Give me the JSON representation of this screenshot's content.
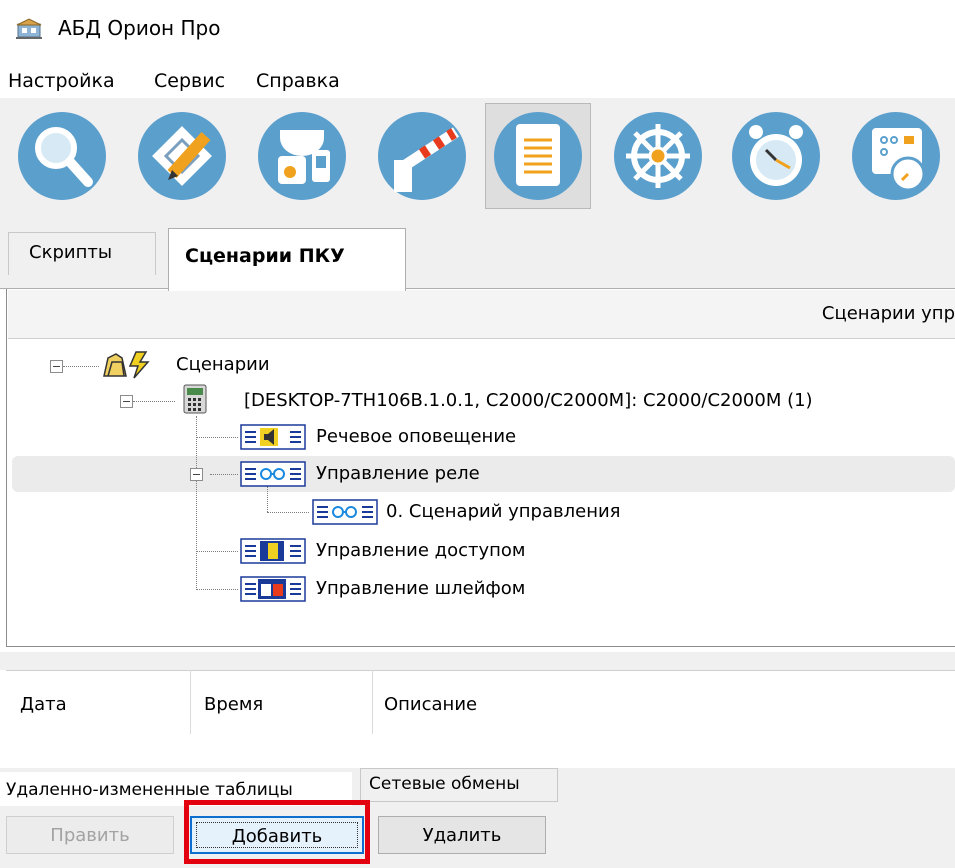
{
  "window": {
    "title": "АБД Орион Про",
    "icon": "app-icon"
  },
  "menu": {
    "items": [
      "Настройка",
      "Сервис",
      "Справка"
    ]
  },
  "toolbar": {
    "icons": [
      "search-icon",
      "plan-edit-icon",
      "device-camera-icon",
      "barrier-icon",
      "document-list-icon",
      "ship-wheel-icon",
      "alarm-clock-icon",
      "schedule-icon"
    ],
    "active_index": 4,
    "accent_color": "#5b9fcd"
  },
  "tabs": {
    "scripts": "Скрипты",
    "pku_scenarios": "Сценарии ПКУ",
    "active": "Сценарии ПКУ"
  },
  "panel": {
    "header": "Сценарии упр"
  },
  "tree": {
    "root": "Сценарии",
    "device": "[DESKTOP-7TH106B.1.0.1, С2000/С2000М]: С2000/С2000М (1)",
    "items": {
      "voice": "Речевое оповещение",
      "relay": "Управление реле",
      "relay_child": "0. Сценарий управления",
      "access": "Управление доступом",
      "loop": "Управление шлейфом"
    }
  },
  "events": {
    "columns": [
      "Дата",
      "Время",
      "Описание"
    ]
  },
  "bottom_tabs": {
    "remote_tables": "Удаленно-измененные таблицы",
    "network": "Сетевые обмены"
  },
  "buttons": {
    "edit": "Править",
    "add": "Добавить",
    "delete": "Удалить"
  },
  "colors": {
    "highlight": "#e3000f",
    "focus": "#0f6fcf"
  }
}
